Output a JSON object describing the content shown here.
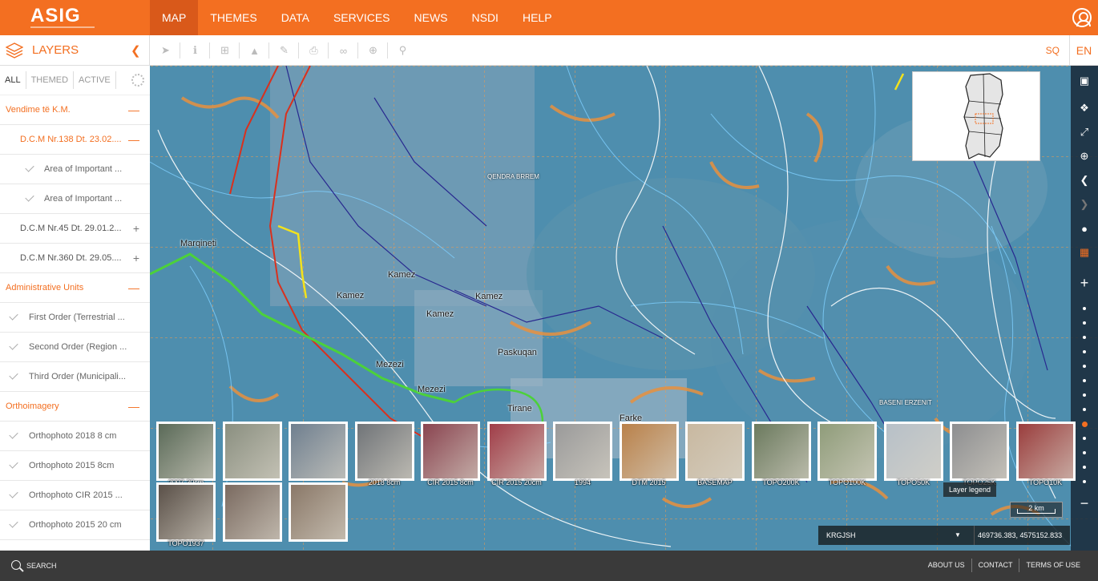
{
  "brand": {
    "logo_text": "ASIG"
  },
  "nav": {
    "items": [
      "MAP",
      "THEMES",
      "DATA",
      "SERVICES",
      "NEWS",
      "NSDI",
      "HELP"
    ],
    "active": "MAP"
  },
  "panel": {
    "title": "LAYERS",
    "tabs": [
      "ALL",
      "THEMED",
      "ACTIVE"
    ],
    "rows": [
      {
        "label": "Vendime të K.M.",
        "type": "group",
        "ctl": "—"
      },
      {
        "label": "D.C.M Nr.138 Dt. 23.02....",
        "type": "sub",
        "ctl": "—"
      },
      {
        "label": "Area of Important ...",
        "type": "leaf-deep"
      },
      {
        "label": "Area of Important ...",
        "type": "leaf-deep"
      },
      {
        "label": "D.C.M Nr.45 Dt. 29.01.2...",
        "type": "sub-gray",
        "ctl": "+"
      },
      {
        "label": "D.C.M Nr.360 Dt. 29.05....",
        "type": "sub-gray",
        "ctl": "+"
      },
      {
        "label": "Administrative Units",
        "type": "group",
        "ctl": "—"
      },
      {
        "label": "First Order (Terrestrial ...",
        "type": "leaf"
      },
      {
        "label": "Second Order (Region ...",
        "type": "leaf"
      },
      {
        "label": "Third Order (Municipali...",
        "type": "leaf"
      },
      {
        "label": "Orthoimagery",
        "type": "group",
        "ctl": "—"
      },
      {
        "label": "Orthophoto 2018 8 cm",
        "type": "leaf"
      },
      {
        "label": "Orthophoto 2015 8cm",
        "type": "leaf"
      },
      {
        "label": "Orthophoto CIR 2015 ...",
        "type": "leaf"
      },
      {
        "label": "Orthophoto 2015 20 cm",
        "type": "leaf"
      }
    ]
  },
  "lang": {
    "sq": "SQ",
    "en": "EN"
  },
  "map": {
    "places": [
      "Marqineti",
      "Kamez",
      "Kamez",
      "Kamez",
      "Kamez",
      "Paskuqan",
      "Mezezi",
      "Mezezi",
      "Tirane",
      "Farke",
      "QENDRA BRREM",
      "BASENI ERZENIT"
    ]
  },
  "basemaps": [
    "2007 20cm",
    "",
    "",
    "2018 8cm",
    "CIR 2015 8cm",
    "CIR 2015 20cm",
    "1994",
    "DTM 2015",
    "BASEMAP",
    "TOPO200K",
    "TOPO100K",
    "TOPO50K",
    "TOPO25K",
    "TOPO10K",
    "TOPO1937",
    "",
    ""
  ],
  "legend": {
    "label": "Layer legend"
  },
  "scale": {
    "label": "2 km"
  },
  "crs": {
    "name": "KRGJSH",
    "coords": "469736.383, 4575152.833"
  },
  "footer": {
    "search": "SEARCH",
    "links": [
      "ABOUT US",
      "CONTACT",
      "TERMS OF USE"
    ]
  },
  "colors": {
    "accent": "#f36f21",
    "map_water": "#4c8aa9"
  }
}
